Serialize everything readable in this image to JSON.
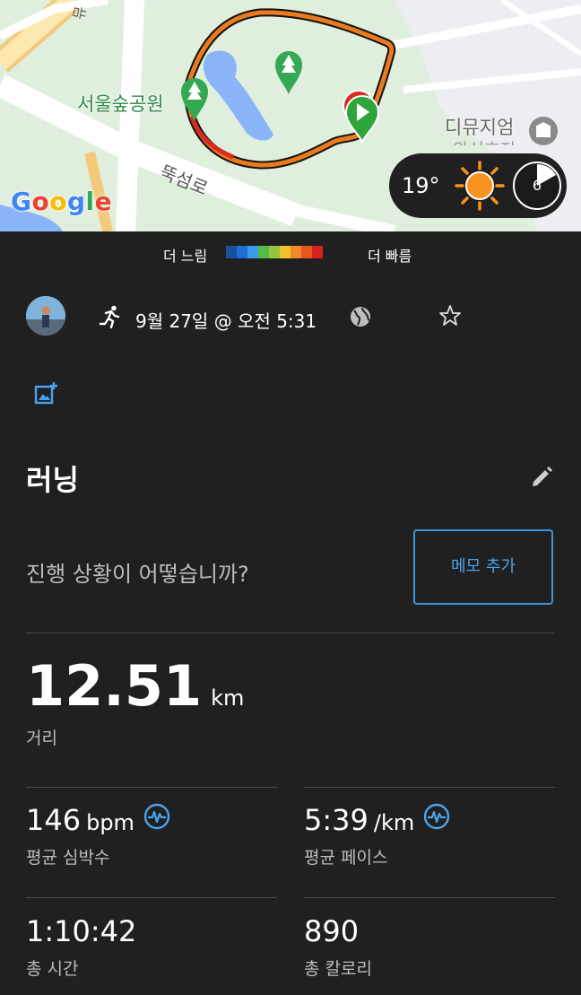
{
  "map": {
    "park_label": "서울숲공원",
    "road_label": "뚝섬로",
    "poi_label": "디뮤지엄",
    "poi_label_partial": "와신호저",
    "road_partial": "뮤",
    "google": [
      "G",
      "o",
      "o",
      "g",
      "l",
      "e"
    ],
    "google_colors": [
      "#4285f4",
      "#ea4335",
      "#fbbc05",
      "#4285f4",
      "#34a853",
      "#ea4335"
    ]
  },
  "weather": {
    "temperature": "19°",
    "uv_index": "6"
  },
  "speed_legend": {
    "slow_label": "더 느림",
    "fast_label": "더 빠름",
    "colors": [
      "#1a4fa0",
      "#1f6fd6",
      "#3a9ce8",
      "#57b947",
      "#93c83e",
      "#f2c12e",
      "#f08a24",
      "#e8561f",
      "#d72020"
    ]
  },
  "activity": {
    "date": "9월 27일 @ 오전 5:31",
    "title": "러닝",
    "prompt": "진행 상황이 어떻습니까?",
    "memo_button": "메모 추가"
  },
  "distance": {
    "value": "12.51",
    "unit": "km",
    "label": "거리"
  },
  "stats": {
    "heart_rate": {
      "value": "146",
      "unit": "bpm",
      "label": "평균 심박수"
    },
    "pace": {
      "value": "5:39",
      "unit": "/km",
      "label": "평균 페이스"
    },
    "time": {
      "value": "1:10:42",
      "label": "총 시간"
    },
    "calories": {
      "value": "890",
      "label": "총 칼로리"
    }
  },
  "colors": {
    "accent": "#4aa3ee",
    "background": "#202020",
    "route": "#e8561f"
  }
}
